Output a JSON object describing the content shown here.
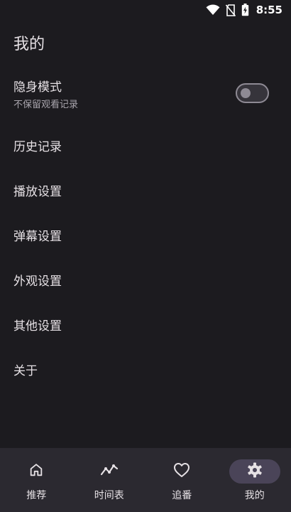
{
  "status_bar": {
    "time": "8:55",
    "icons": [
      "wifi-icon",
      "no-sim-icon",
      "battery-charging-icon"
    ]
  },
  "header": {
    "title": "我的"
  },
  "settings": {
    "incognito": {
      "title": "隐身模式",
      "subtitle": "不保留观看记录",
      "enabled": false
    },
    "items": [
      {
        "label": "历史记录"
      },
      {
        "label": "播放设置"
      },
      {
        "label": "弹幕设置"
      },
      {
        "label": "外观设置"
      },
      {
        "label": "其他设置"
      },
      {
        "label": "关于"
      }
    ]
  },
  "bottom_nav": {
    "active": "我的",
    "items": [
      {
        "label": "推荐",
        "icon": "home-icon"
      },
      {
        "label": "时间表",
        "icon": "trend-icon"
      },
      {
        "label": "追番",
        "icon": "heart-icon"
      },
      {
        "label": "我的",
        "icon": "gear-icon"
      }
    ]
  },
  "colors": {
    "background": "#1c1b1f",
    "nav_background": "#2b2930",
    "active_indicator": "#4a4458",
    "text_primary": "#e6e1e5",
    "text_secondary": "#a9a5ad"
  }
}
